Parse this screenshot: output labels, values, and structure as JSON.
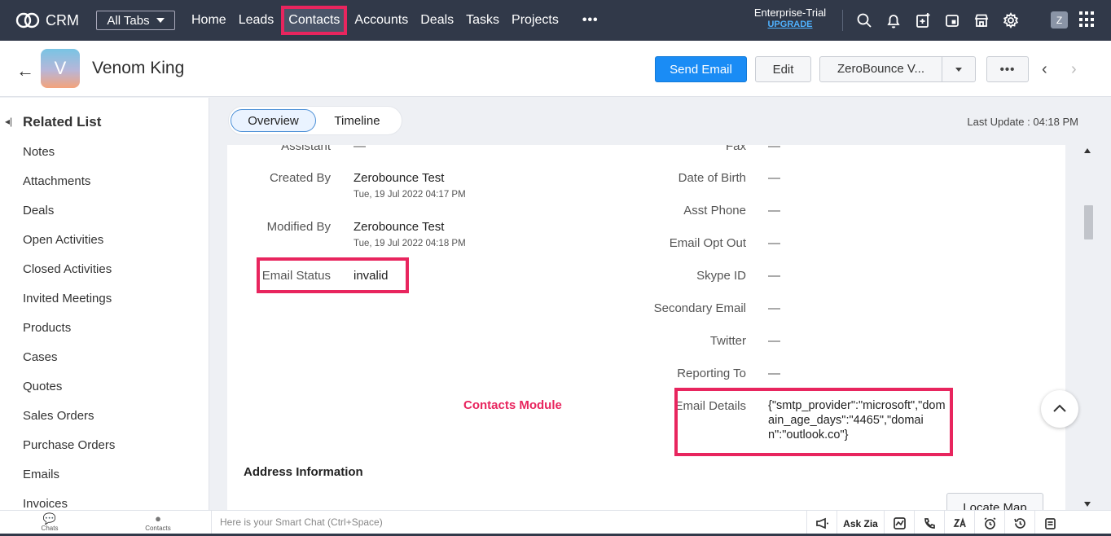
{
  "nav": {
    "app_name": "CRM",
    "all_tabs": "All Tabs",
    "tabs": [
      "Home",
      "Leads",
      "Contacts",
      "Accounts",
      "Deals",
      "Tasks",
      "Projects"
    ],
    "more": "•••",
    "trial_label": "Enterprise-Trial",
    "upgrade": "UPGRADE",
    "icons": [
      "search-icon",
      "bell-icon",
      "add-note-icon",
      "calendar-icon",
      "marketplace-icon",
      "gear-icon"
    ],
    "user_initial": "Z"
  },
  "record": {
    "back": "←",
    "avatar_initial": "V",
    "name": "Venom King",
    "send_email": "Send Email",
    "edit": "Edit",
    "zerobounce": "ZeroBounce V...",
    "more": "•••",
    "prev": "‹",
    "next": "›"
  },
  "sidebar": {
    "title": "Related List",
    "items": [
      "Notes",
      "Attachments",
      "Deals",
      "Open Activities",
      "Closed Activities",
      "Invited Meetings",
      "Products",
      "Cases",
      "Quotes",
      "Sales Orders",
      "Purchase Orders",
      "Emails",
      "Invoices"
    ]
  },
  "tabs": {
    "overview": "Overview",
    "timeline": "Timeline",
    "last_update": "Last Update : 04:18 PM"
  },
  "details_left": {
    "assistant": {
      "label": "Assistant",
      "value": "—"
    },
    "created_by": {
      "label": "Created By",
      "value": "Zerobounce Test",
      "sub": "Tue, 19 Jul 2022 04:17 PM"
    },
    "modified_by": {
      "label": "Modified By",
      "value": "Zerobounce Test",
      "sub": "Tue, 19 Jul 2022 04:18 PM"
    },
    "email_status": {
      "label": "Email Status",
      "value": "invalid"
    }
  },
  "details_right": [
    {
      "label": "Fax",
      "value": "—"
    },
    {
      "label": "Date of Birth",
      "value": "—"
    },
    {
      "label": "Asst Phone",
      "value": "—"
    },
    {
      "label": "Email Opt Out",
      "value": "—"
    },
    {
      "label": "Skype ID",
      "value": "—"
    },
    {
      "label": "Secondary Email",
      "value": "—"
    },
    {
      "label": "Twitter",
      "value": "—"
    },
    {
      "label": "Reporting To",
      "value": "—"
    }
  ],
  "email_details": {
    "label": "Email Details",
    "value": "{\"smtp_provider\":\"microsoft\",\"domain_age_days\":\"4465\",\"domain\":\"outlook.co\"}"
  },
  "annotation": "Contacts Module",
  "address_section": "Address Information",
  "locate_map": "Locate Map",
  "bottom": {
    "chats": "Chats",
    "contacts": "Contacts",
    "smart_chat_placeholder": "Here is your Smart Chat (Ctrl+Space)",
    "ask_zia": "Ask Zia"
  },
  "colors": {
    "nav_bg": "#313949",
    "highlight": "#e8255e",
    "primary": "#1a8cf5"
  }
}
